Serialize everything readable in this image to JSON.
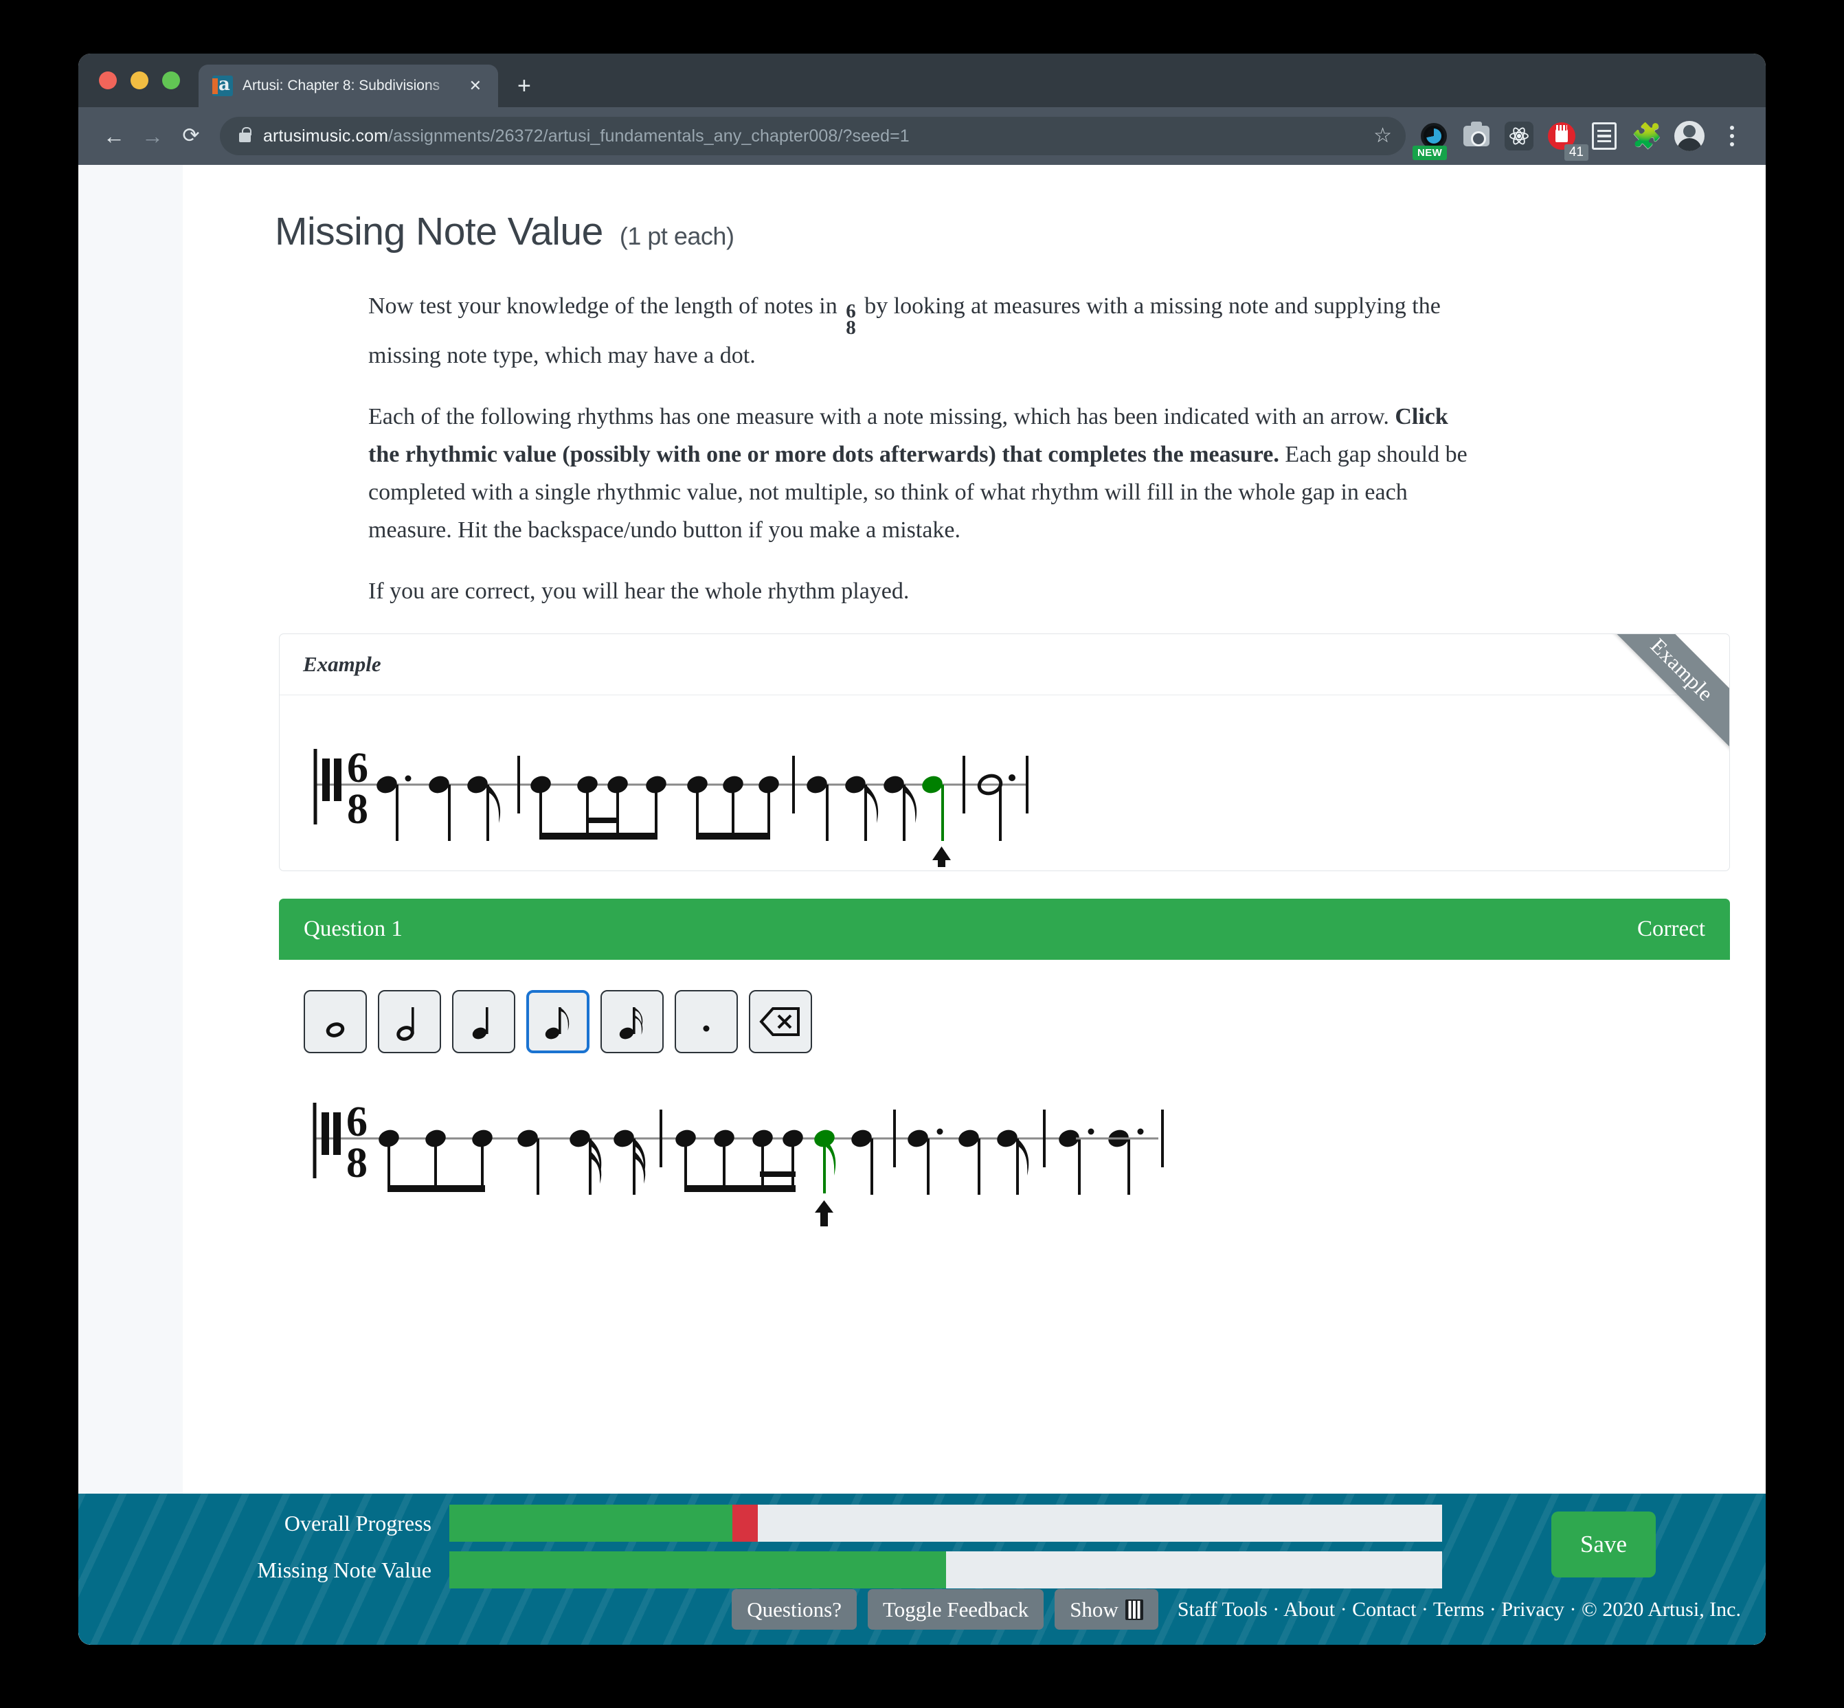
{
  "browser": {
    "tab_title": "Artusi: Chapter 8: Subdivisions",
    "tab_close_glyph": "✕",
    "new_tab_glyph": "+",
    "back_glyph": "←",
    "forward_glyph": "→",
    "reload_glyph": "⟳",
    "url_domain": "artusimusic.com",
    "url_path": "/assignments/26372/artusi_fundamentals_any_chapter008/?seed=1",
    "star_glyph": "☆",
    "extensions": {
      "clock_badge": "NEW",
      "blocker_count": "41"
    }
  },
  "page": {
    "title": "Missing Note Value",
    "points": "(1 pt each)",
    "paragraphs": {
      "p1_before": "Now test your knowledge of the length of notes in",
      "p1_timesig_top": "6",
      "p1_timesig_bottom": "8",
      "p1_after": "by looking at measures with a missing note and supplying the missing note type, which may have a dot.",
      "p2_a": "Each of the following rhythms has one measure with a note missing, which has been indicated with an arrow.",
      "p2_bold": "Click the rhythmic value (possibly with one or more dots afterwards) that completes the measure.",
      "p2_b": "Each gap should be completed with a single rhythmic value, not multiple, so think of what rhythm will fill in the whole gap in each measure. Hit the backspace/undo button if you make a mistake.",
      "p3": "If you are correct, you will hear the whole rhythm played."
    }
  },
  "example_card": {
    "header_label": "Example",
    "ribbon_label": "Example",
    "time_signature_top": "6",
    "time_signature_bottom": "8",
    "answer_note_color": "#008000"
  },
  "question_card": {
    "header_label": "Question 1",
    "status_label": "Correct",
    "status_color": "#2fa84f",
    "time_signature_top": "6",
    "time_signature_bottom": "8",
    "answer_note_color": "#008000",
    "palette": [
      {
        "name": "whole-note",
        "label": "whole note"
      },
      {
        "name": "half-note",
        "label": "half note"
      },
      {
        "name": "quarter-note",
        "label": "quarter note"
      },
      {
        "name": "eighth-note",
        "label": "eighth note",
        "selected": true
      },
      {
        "name": "sixteenth-note",
        "label": "sixteenth note"
      },
      {
        "name": "augmentation-dot",
        "label": "dot"
      },
      {
        "name": "backspace",
        "label": "backspace"
      }
    ]
  },
  "footer": {
    "progress": [
      {
        "label": "Overall Progress",
        "green_pct": 28.5,
        "red_pct": 2.6
      },
      {
        "label": "Missing Note Value",
        "green_pct": 50.0,
        "red_pct": 0
      }
    ],
    "save_label": "Save",
    "buttons": {
      "questions": "Questions?",
      "toggle_feedback": "Toggle Feedback",
      "show": "Show"
    },
    "links": "Staff Tools · About · Contact · Terms · Privacy · © 2020 Artusi, Inc.",
    "bg_color": "#046c88"
  }
}
